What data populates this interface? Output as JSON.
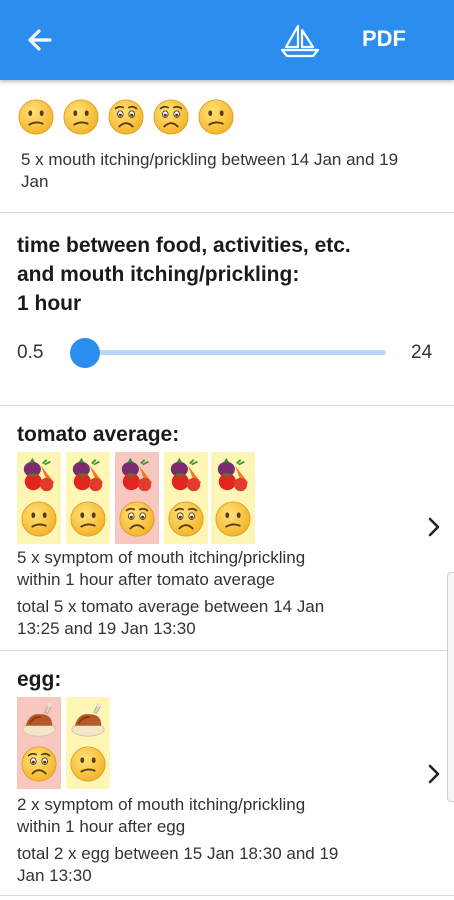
{
  "appbar": {
    "pdf_label": "PDF",
    "color": "#2b8ded"
  },
  "summary": {
    "text": "5 x mouth itching/prickling between 14 Jan and 19 Jan"
  },
  "filter": {
    "title_line1": "time between food, activities, etc.",
    "title_line2": "and mouth itching/prickling:",
    "title_line3": "1 hour",
    "min_label": "0.5",
    "max_label": "24",
    "value_hours": 1,
    "accent": "#2b8ded"
  },
  "foods": [
    {
      "title": "tomato average:",
      "line1": "5 x symptom of mouth itching/prickling",
      "line2": "within 1 hour after tomato average",
      "total1": "total 5 x tomato average between 14 Jan",
      "total2": "13:25 and 19 Jan 13:30"
    },
    {
      "title": "egg:",
      "line1": "2 x symptom of mouth itching/prickling",
      "line2": "within 1 hour after egg",
      "total1": "total 2 x egg between 15 Jan 18:30 and 19",
      "total2": "Jan 13:30"
    }
  ],
  "colors": {
    "cell_yellow": "#fdf6b4",
    "cell_red": "#f8c8c0",
    "divider": "#dcdcdc"
  }
}
